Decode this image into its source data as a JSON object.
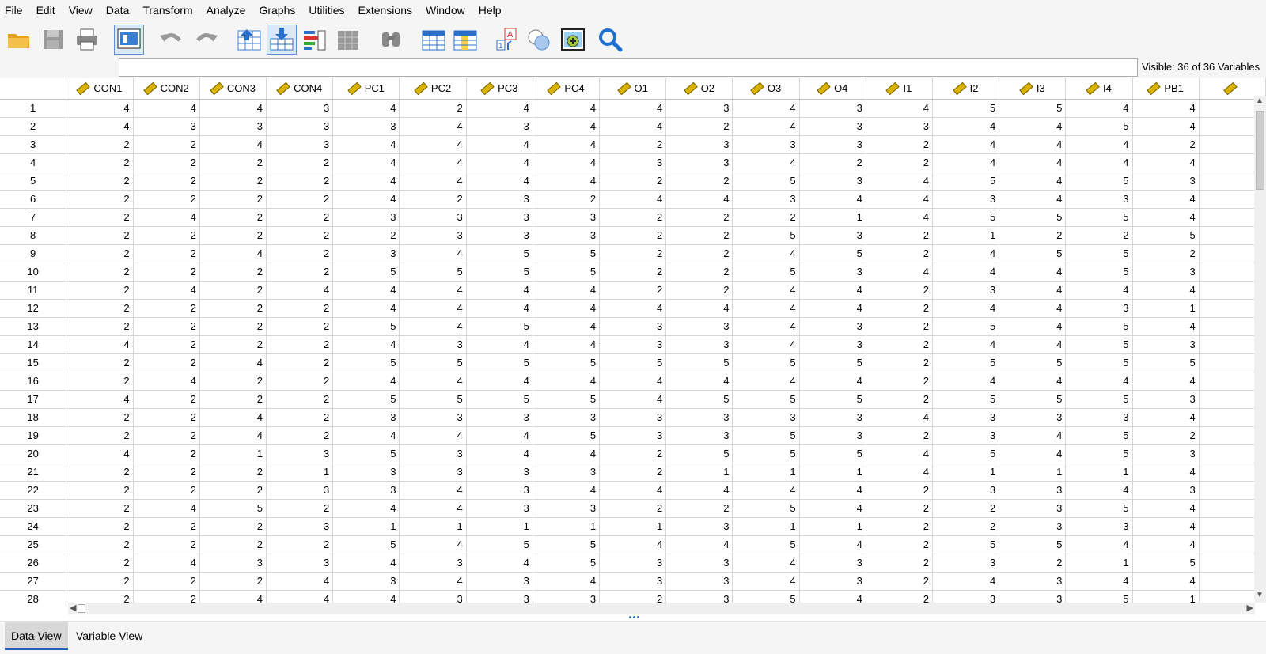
{
  "menu": [
    "File",
    "Edit",
    "View",
    "Data",
    "Transform",
    "Analyze",
    "Graphs",
    "Utilities",
    "Extensions",
    "Window",
    "Help"
  ],
  "toolbar_icons": [
    "open-folder-icon",
    "save-icon",
    "print-icon",
    "dialog-recall-icon",
    "undo-icon",
    "redo-icon",
    "goto-case-icon",
    "goto-variable-icon",
    "variables-icon",
    "run-descriptives-icon",
    "find-icon",
    "insert-cases-icon",
    "insert-variable-icon",
    "split-file-icon",
    "weight-cases-icon",
    "select-cases-icon",
    "value-labels-icon",
    "use-sets-icon",
    "search-icon"
  ],
  "cell_editor": {
    "value": ""
  },
  "visible_label": "Visible: 36 of 36 Variables",
  "columns": [
    "CON1",
    "CON2",
    "CON3",
    "CON4",
    "PC1",
    "PC2",
    "PC3",
    "PC4",
    "O1",
    "O2",
    "O3",
    "O4",
    "I1",
    "I2",
    "I3",
    "I4",
    "PB1",
    ""
  ],
  "rows": [
    [
      4,
      4,
      4,
      3,
      4,
      2,
      4,
      4,
      4,
      3,
      4,
      3,
      4,
      5,
      5,
      4,
      4
    ],
    [
      4,
      3,
      3,
      3,
      3,
      4,
      3,
      4,
      4,
      2,
      4,
      3,
      3,
      4,
      4,
      5,
      4
    ],
    [
      2,
      2,
      4,
      3,
      4,
      4,
      4,
      4,
      2,
      3,
      3,
      3,
      2,
      4,
      4,
      4,
      2
    ],
    [
      2,
      2,
      2,
      2,
      4,
      4,
      4,
      4,
      3,
      3,
      4,
      2,
      2,
      4,
      4,
      4,
      4
    ],
    [
      2,
      2,
      2,
      2,
      4,
      4,
      4,
      4,
      2,
      2,
      5,
      3,
      4,
      5,
      4,
      5,
      3
    ],
    [
      2,
      2,
      2,
      2,
      4,
      2,
      3,
      2,
      4,
      4,
      3,
      4,
      4,
      3,
      4,
      3,
      4
    ],
    [
      2,
      4,
      2,
      2,
      3,
      3,
      3,
      3,
      2,
      2,
      2,
      1,
      4,
      5,
      5,
      5,
      4
    ],
    [
      2,
      2,
      2,
      2,
      2,
      3,
      3,
      3,
      2,
      2,
      5,
      3,
      2,
      1,
      2,
      2,
      5
    ],
    [
      2,
      2,
      4,
      2,
      3,
      4,
      5,
      5,
      2,
      2,
      4,
      5,
      2,
      4,
      5,
      5,
      2
    ],
    [
      2,
      2,
      2,
      2,
      5,
      5,
      5,
      5,
      2,
      2,
      5,
      3,
      4,
      4,
      4,
      5,
      3
    ],
    [
      2,
      4,
      2,
      4,
      4,
      4,
      4,
      4,
      2,
      2,
      4,
      4,
      2,
      3,
      4,
      4,
      4
    ],
    [
      2,
      2,
      2,
      2,
      4,
      4,
      4,
      4,
      4,
      4,
      4,
      4,
      2,
      4,
      4,
      3,
      1
    ],
    [
      2,
      2,
      2,
      2,
      5,
      4,
      5,
      4,
      3,
      3,
      4,
      3,
      2,
      5,
      4,
      5,
      4
    ],
    [
      4,
      2,
      2,
      2,
      4,
      3,
      4,
      4,
      3,
      3,
      4,
      3,
      2,
      4,
      4,
      5,
      3
    ],
    [
      2,
      2,
      4,
      2,
      5,
      5,
      5,
      5,
      5,
      5,
      5,
      5,
      2,
      5,
      5,
      5,
      5
    ],
    [
      2,
      4,
      2,
      2,
      4,
      4,
      4,
      4,
      4,
      4,
      4,
      4,
      2,
      4,
      4,
      4,
      4
    ],
    [
      4,
      2,
      2,
      2,
      5,
      5,
      5,
      5,
      4,
      5,
      5,
      5,
      2,
      5,
      5,
      5,
      3
    ],
    [
      2,
      2,
      4,
      2,
      3,
      3,
      3,
      3,
      3,
      3,
      3,
      3,
      4,
      3,
      3,
      3,
      4
    ],
    [
      2,
      2,
      4,
      2,
      4,
      4,
      4,
      5,
      3,
      3,
      5,
      3,
      2,
      3,
      4,
      5,
      2
    ],
    [
      4,
      2,
      1,
      3,
      5,
      3,
      4,
      4,
      2,
      5,
      5,
      5,
      4,
      5,
      4,
      5,
      3
    ],
    [
      2,
      2,
      2,
      1,
      3,
      3,
      3,
      3,
      2,
      1,
      1,
      1,
      4,
      1,
      1,
      1,
      4
    ],
    [
      2,
      2,
      2,
      3,
      3,
      4,
      3,
      4,
      4,
      4,
      4,
      4,
      2,
      3,
      3,
      4,
      3
    ],
    [
      2,
      4,
      5,
      2,
      4,
      4,
      3,
      3,
      2,
      2,
      5,
      4,
      2,
      2,
      3,
      5,
      4
    ],
    [
      2,
      2,
      2,
      3,
      1,
      1,
      1,
      1,
      1,
      3,
      1,
      1,
      2,
      2,
      3,
      3,
      4
    ],
    [
      2,
      2,
      2,
      2,
      5,
      4,
      5,
      5,
      4,
      4,
      5,
      4,
      2,
      5,
      5,
      4,
      4
    ],
    [
      2,
      4,
      3,
      3,
      4,
      3,
      4,
      5,
      3,
      3,
      4,
      3,
      2,
      3,
      2,
      1,
      5
    ],
    [
      2,
      2,
      2,
      4,
      3,
      4,
      3,
      4,
      3,
      3,
      4,
      3,
      2,
      4,
      3,
      4,
      4
    ],
    [
      2,
      2,
      4,
      4,
      4,
      3,
      3,
      3,
      2,
      3,
      5,
      4,
      2,
      3,
      3,
      5,
      1
    ]
  ],
  "tabs": [
    "Data View",
    "Variable View"
  ]
}
